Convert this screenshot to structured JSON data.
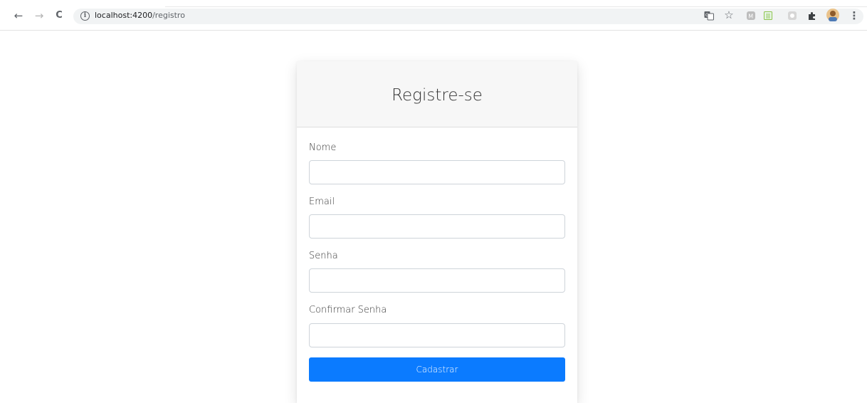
{
  "browser": {
    "url_host": "localhost:4200",
    "url_path": "/registro",
    "back_icon": "←",
    "forward_icon": "→",
    "reload_icon": "C",
    "info_icon": "i",
    "star_icon": "☆",
    "menu_icon": "⋮"
  },
  "form": {
    "title": "Registre-se",
    "fields": [
      {
        "label": "Nome",
        "value": ""
      },
      {
        "label": "Email",
        "value": ""
      },
      {
        "label": "Senha",
        "value": ""
      },
      {
        "label": "Confirmar Senha",
        "value": ""
      }
    ],
    "submit_label": "Cadastrar"
  },
  "colors": {
    "accent": "#0b7bff",
    "header_bg": "#f7f7f7"
  }
}
